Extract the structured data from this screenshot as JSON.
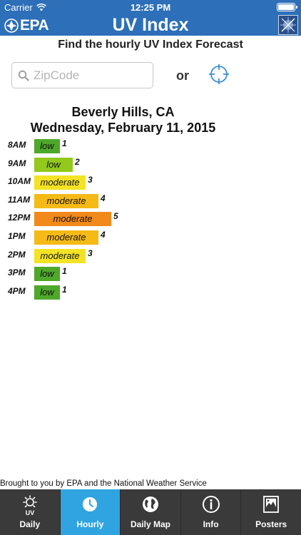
{
  "status_bar": {
    "carrier": "Carrier",
    "time": "12:25 PM"
  },
  "header": {
    "logo_text": "EPA",
    "title": "UV Index"
  },
  "search": {
    "heading": "Find the hourly UV Index Forecast",
    "zip_placeholder": "ZipCode",
    "zip_value": "",
    "or_label": "or"
  },
  "forecast": {
    "location": "Beverly Hills, CA",
    "date": "Wednesday, February 11, 2015"
  },
  "chart_data": {
    "type": "bar",
    "categories": [
      "8AM",
      "9AM",
      "10AM",
      "11AM",
      "12PM",
      "1PM",
      "2PM",
      "3PM",
      "4PM"
    ],
    "values": [
      1,
      2,
      3,
      4,
      5,
      4,
      3,
      1,
      1
    ],
    "levels": [
      "low",
      "low",
      "moderate",
      "moderate",
      "moderate",
      "moderate",
      "moderate",
      "low",
      "low"
    ],
    "colors": [
      "#4ea82a",
      "#92c91c",
      "#f3e324",
      "#f5ba16",
      "#f1891b",
      "#f5ba16",
      "#f3e324",
      "#4ea82a",
      "#4ea82a"
    ],
    "xlim": [
      0,
      5
    ]
  },
  "footer": {
    "credit": "Brought to you by EPA and the National Weather Service"
  },
  "tabs": [
    {
      "label": "Daily",
      "icon": "sun-uv-icon",
      "active": false
    },
    {
      "label": "Hourly",
      "icon": "clock-icon",
      "active": true
    },
    {
      "label": "Daily Map",
      "icon": "globe-icon",
      "active": false
    },
    {
      "label": "Info",
      "icon": "info-icon",
      "active": false
    },
    {
      "label": "Posters",
      "icon": "image-icon",
      "active": false
    }
  ]
}
